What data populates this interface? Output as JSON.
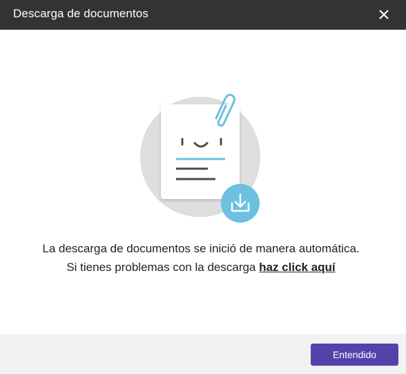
{
  "dialog": {
    "title": "Descarga de documentos",
    "message_line1": "La descarga de documentos se inició de manera automática.",
    "message_line2_prefix": "Si tienes problemas con la descarga ",
    "message_link": "haz click aquí",
    "confirm_label": "Entendido"
  },
  "icons": {
    "close": "close-icon",
    "illustration": "document-download-illustration",
    "paperclip": "paperclip-icon",
    "download": "download-icon"
  },
  "colors": {
    "header_bg": "#333333",
    "accent": "#5243aa",
    "illustration_blue": "#6cc0e0",
    "footer_bg": "#f2f2f2"
  }
}
